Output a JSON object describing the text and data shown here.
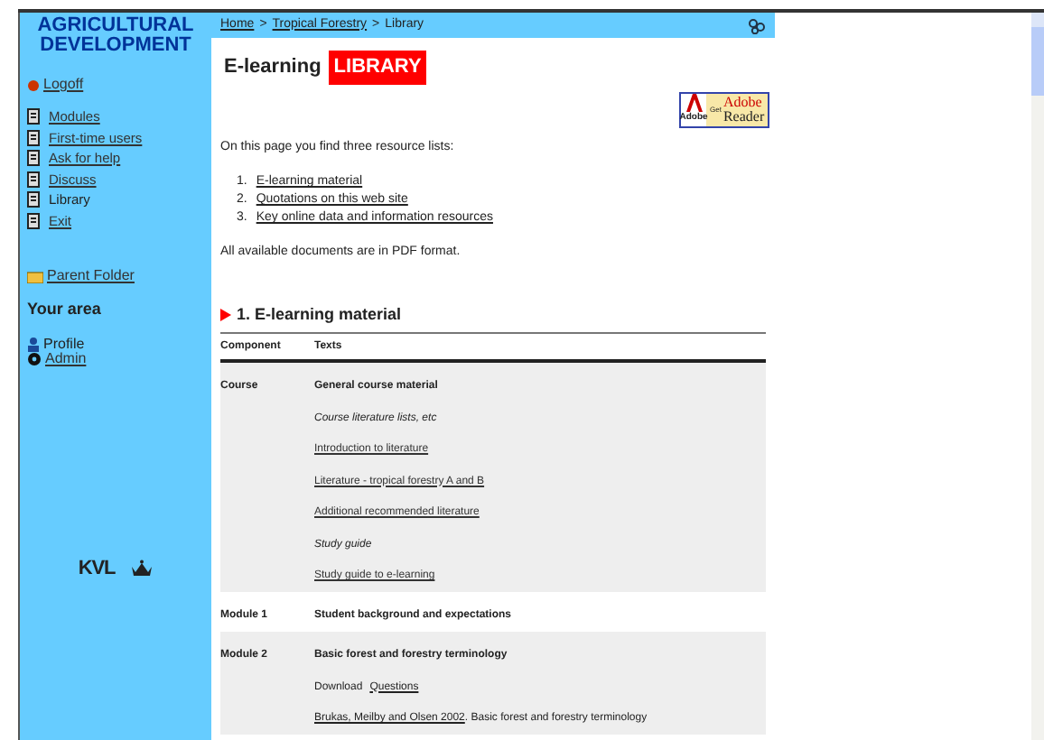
{
  "sidebar": {
    "title_lines": [
      "AGRICULTURAL",
      "DEVELOPMENT"
    ],
    "logoff": "Logoff",
    "items": [
      {
        "label": "Modules",
        "selected": false
      },
      {
        "label": "First-time users",
        "selected": false
      },
      {
        "label": "Ask for help",
        "selected": false
      },
      {
        "label": "Discuss",
        "selected": false
      },
      {
        "label": "Library",
        "selected": true
      },
      {
        "label": "Exit",
        "selected": false
      }
    ],
    "parent_folder": "Parent Folder",
    "your_area": "Your area",
    "profile": "Profile",
    "admin": "Admin",
    "logo_text": "KVL"
  },
  "breadcrumb": [
    {
      "label": "Home",
      "link": true
    },
    {
      "label": ">",
      "link": false
    },
    {
      "label": "Tropical Forestry",
      "link": true
    },
    {
      "label": ">",
      "link": false
    },
    {
      "label": "Library",
      "link": false
    }
  ],
  "heading": {
    "text": "E-learning",
    "badge": "LIBRARY"
  },
  "adobe_badge": {
    "get": "Get",
    "brand": "Adobe",
    "product": "Reader",
    "small": "Adobe"
  },
  "intro": "On this page you find three resource lists:",
  "resource_lists": [
    {
      "number": "1.",
      "label": "E-learning material"
    },
    {
      "number": "2.",
      "label": "Quotations on this web site"
    },
    {
      "number": "3.",
      "label": "Key online data and information resources"
    }
  ],
  "pdf_note": "All available documents are in PDF format.",
  "section_title": "1. E-learning material",
  "table": {
    "columns": [
      "Component",
      "Texts"
    ],
    "rows": [
      {
        "component": "Course",
        "shaded": true,
        "items": [
          {
            "kind": "heading",
            "text": "General course material"
          },
          {
            "kind": "italic",
            "text": "Course literature lists, etc"
          },
          {
            "kind": "link",
            "text": "Introduction to literature"
          },
          {
            "kind": "link",
            "text": "Literature - tropical forestry A and B"
          },
          {
            "kind": "link",
            "text": "Additional recommended literature"
          },
          {
            "kind": "italic",
            "text": "Study guide"
          },
          {
            "kind": "link",
            "text": "Study guide to e-learning"
          }
        ]
      },
      {
        "component": "Module 1",
        "shaded": false,
        "items": [
          {
            "kind": "heading",
            "text": "Student background and expectations"
          }
        ]
      },
      {
        "component": "Module 2",
        "shaded": true,
        "items": [
          {
            "kind": "heading",
            "text": "Basic forest and forestry terminology"
          },
          {
            "kind": "text_link",
            "text": "Download",
            "link": "Questions"
          },
          {
            "kind": "link_text",
            "link": "Brukas, Meilby and Olsen 2002",
            "text": ". Basic forest and forestry terminology"
          }
        ]
      }
    ]
  }
}
